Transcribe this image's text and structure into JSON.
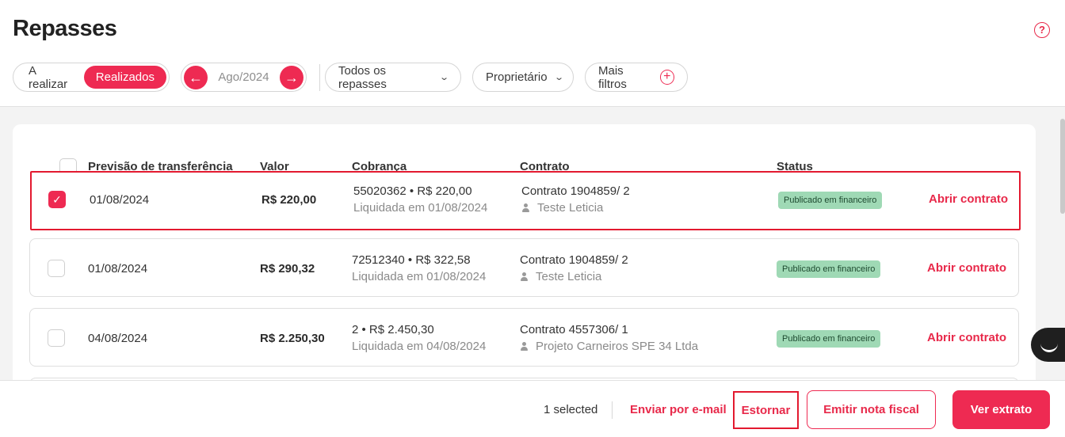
{
  "header": {
    "title": "Repasses",
    "help_icon": "?"
  },
  "filters": {
    "toggle": {
      "option_a": "A realizar",
      "option_b": "Realizados",
      "active": "Realizados"
    },
    "period": {
      "prev": "←",
      "label": "Ago/2024",
      "next": "→"
    },
    "dropdown_repasses": "Todos os repasses",
    "dropdown_owner": "Proprietário",
    "more_filters": "Mais filtros",
    "chevron": "⌄",
    "plus": "+"
  },
  "table": {
    "columns": {
      "transfer_date": "Previsão de transferência",
      "value": "Valor",
      "billing": "Cobrança",
      "contract": "Contrato",
      "status": "Status"
    },
    "rows": [
      {
        "checked": true,
        "date": "01/08/2024",
        "value": "R$ 220,00",
        "billing_main": "55020362 • R$ 220,00",
        "billing_sub": "Liquidada em 01/08/2024",
        "contract": "Contrato 1904859/ 2",
        "tenant": "Teste Leticia",
        "status": "Publicado em financeiro",
        "action": "Abrir contrato"
      },
      {
        "checked": false,
        "date": "01/08/2024",
        "value": "R$ 290,32",
        "billing_main": "72512340 • R$ 322,58",
        "billing_sub": "Liquidada em 01/08/2024",
        "contract": "Contrato 1904859/ 2",
        "tenant": "Teste Leticia",
        "status": "Publicado em financeiro",
        "action": "Abrir contrato"
      },
      {
        "checked": false,
        "date": "04/08/2024",
        "value": "R$ 2.250,30",
        "billing_main": "2 • R$ 2.450,30",
        "billing_sub": "Liquidada em 04/08/2024",
        "contract": "Contrato 4557306/ 1",
        "tenant": "Projeto Carneiros SPE 34 Ltda",
        "status": "Publicado em financeiro",
        "action": "Abrir contrato"
      }
    ],
    "check_mark": "✓"
  },
  "footer": {
    "selected_count": "1 selected",
    "email": "Enviar por e-mail",
    "reverse": "Estornar",
    "invoice": "Emitir nota fiscal",
    "statement": "Ver extrato"
  },
  "colors": {
    "accent": "#ee2a52",
    "status_badge": "#9fd9b5",
    "highlight_border": "#e3192f"
  }
}
